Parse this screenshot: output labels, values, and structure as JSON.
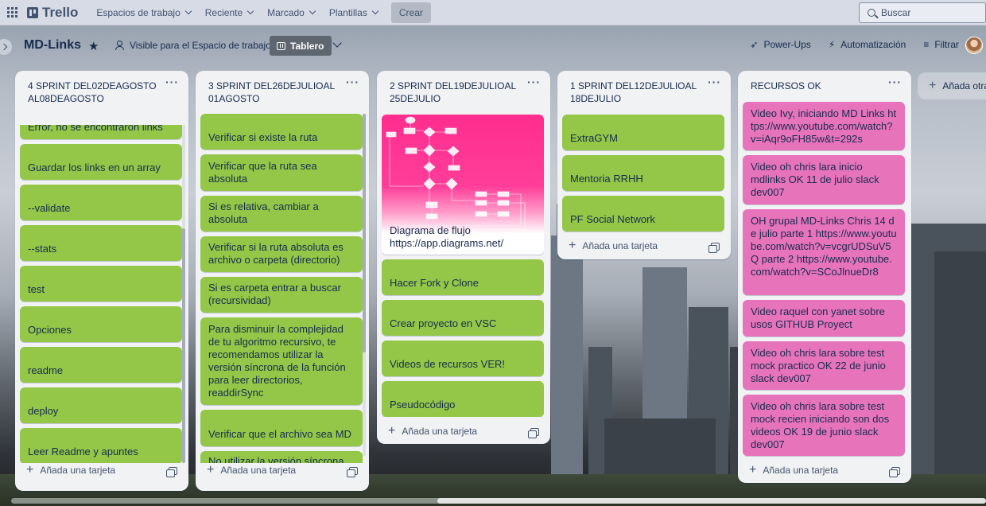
{
  "topbar": {
    "logo": "Trello",
    "menus": [
      "Espacios de trabajo",
      "Reciente",
      "Marcado",
      "Plantillas"
    ],
    "create": "Crear",
    "search_placeholder": "Buscar"
  },
  "board": {
    "title": "MD-Links",
    "visibility": "Visible para el Espacio de trabajo",
    "view": "Tablero",
    "actions": {
      "powerups": "Power-Ups",
      "automation": "Automatización",
      "filter": "Filtrar"
    }
  },
  "lists": [
    {
      "title": "4 SPRINT DEL02DEAGOSTOAL08DEAGOSTO",
      "cards": [
        "Error, no se encontraron links",
        "Guardar los links en un array",
        "--validate",
        "--stats",
        "test",
        "Opciones",
        "readme",
        "deploy",
        "Leer Readme y apuntes"
      ],
      "add": "Añada una tarjeta"
    },
    {
      "title": "3 SPRINT DEL26DEJULIOAL01AGOSTO",
      "cards": [
        "Verificar si existe la ruta",
        "Verificar que la ruta sea absoluta",
        "Si es relativa, cambiar a absoluta",
        "Verificar si la ruta absoluta es archivo o carpeta (directorio)",
        "Si es carpeta entrar a buscar (recursividad)",
        "Para disminuir la complejidad de tu algoritmo recursivo, te recomendamos utilizar la versión síncrona de la función para leer directorios, readdirSync",
        "Verificar que el archivo sea MD",
        "No utilizar la versión síncrona"
      ],
      "add": "Añada una tarjeta"
    },
    {
      "title": "2 SPRINT DEL19DEJULIOAL25DEJULIO",
      "cover_card": "Diagrama de flujo https://app.diagrams.net/",
      "cards": [
        "Hacer Fork y Clone",
        "Crear proyecto en VSC",
        "Videos de recursos VER!",
        "Pseudocódigo"
      ],
      "add": "Añada una tarjeta"
    },
    {
      "title": "1 SPRINT DEL12DEJULIOAL18DEJULIO",
      "cards": [
        "ExtraGYM",
        "Mentoria RRHH",
        "PF Social Network"
      ],
      "add": "Añada una tarjeta"
    },
    {
      "title": "RECURSOS OK",
      "cards": [
        "Video Ivy, iniciando MD Links https://www.youtube.com/watch?v=iAqr9oFH85w&t=292s",
        "Video oh chris lara inicio mdlinks OK 11 de julio slack dev007",
        "OH grupal MD-Links Chris 14 de julio parte 1 https://www.youtube.com/watch?v=vcgrUDSuV5Q parte 2 https://www.youtube.com/watch?v=SCoJlnueDr8",
        "Video raquel con yanet sobre usos GITHUB Proyect",
        "Video oh chris lara sobre test mock practico OK 22 de junio slack dev007",
        "Video oh chris lara sobre test mock recien iniciando son dos videos OK 19 de junio slack dev007"
      ],
      "add": "Añada una tarjeta"
    }
  ],
  "add_list": "Añada otra lista",
  "colors": {
    "green_card": "#94c748",
    "pink_card": "#e774bb",
    "cover": "#ff2d8e"
  }
}
